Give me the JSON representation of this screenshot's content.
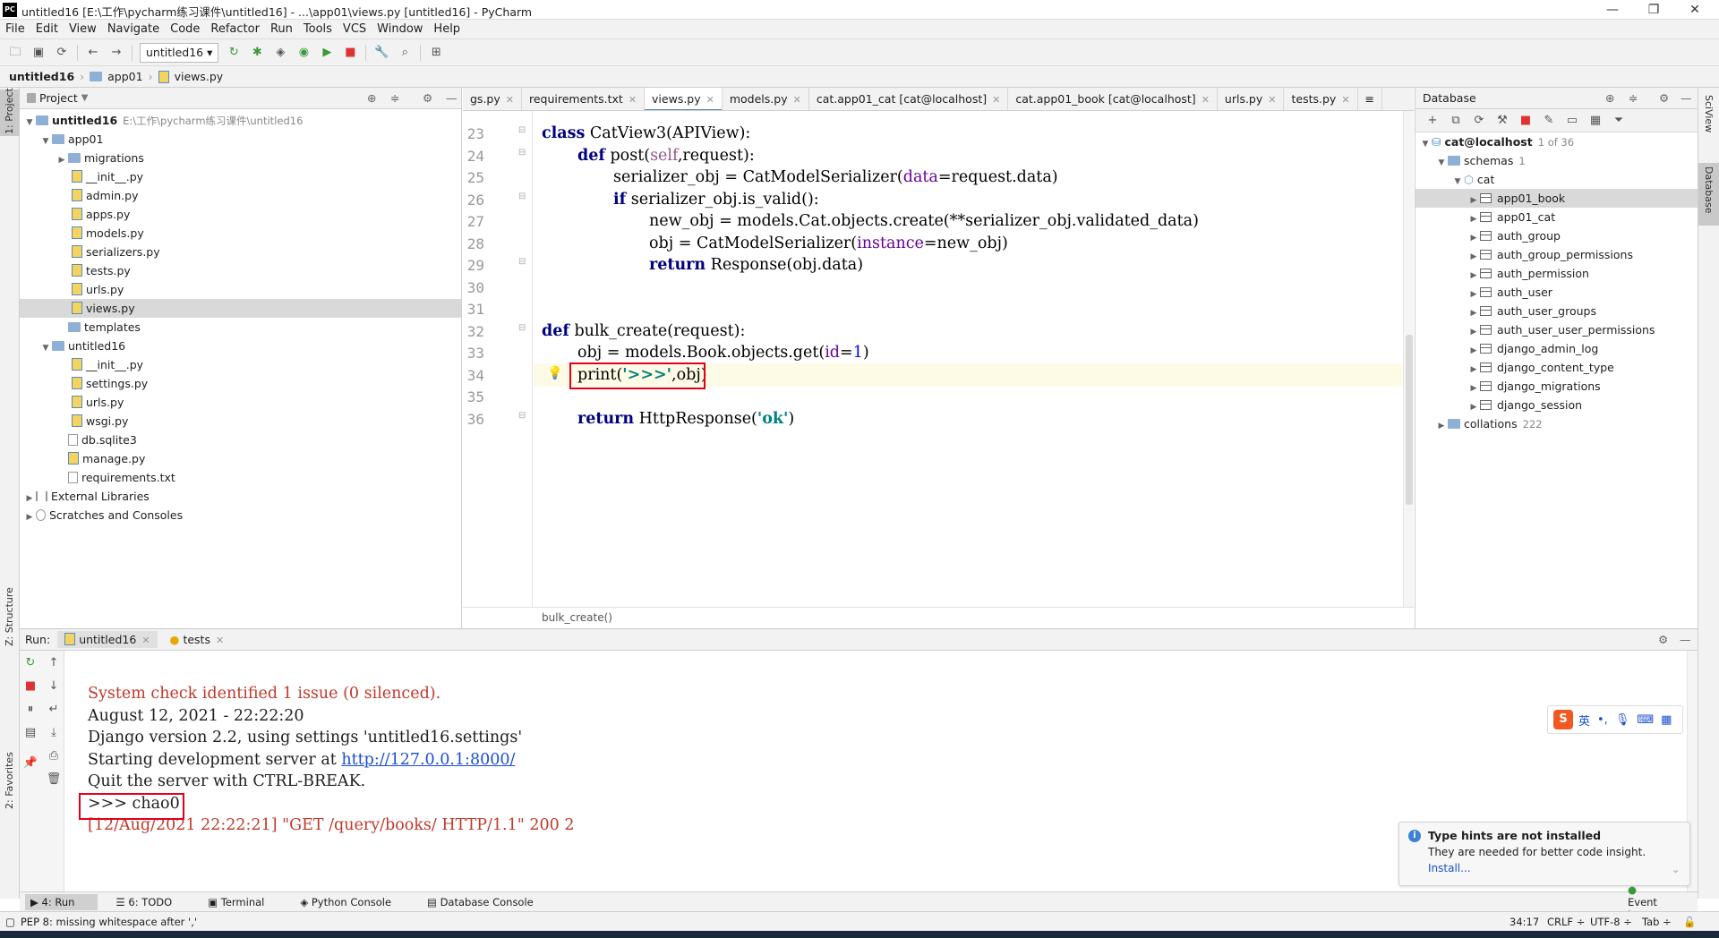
{
  "window": {
    "title": "untitled16 [E:\\工作\\pycharm练习课件\\untitled16] - ...\\app01\\views.py [untitled16] - PyCharm",
    "app_icon": "PC",
    "minimize": "—",
    "restore": "❐",
    "close": "✕"
  },
  "menu": [
    "File",
    "Edit",
    "View",
    "Navigate",
    "Code",
    "Refactor",
    "Run",
    "Tools",
    "VCS",
    "Window",
    "Help"
  ],
  "toolbar": {
    "run_config": "untitled16"
  },
  "navbar": {
    "crumbs": [
      "untitled16",
      "app01",
      "views.py"
    ]
  },
  "stripes": {
    "left_top": "1: Project",
    "left_mid": "Z: Structure",
    "left_bottom": "2: Favorites",
    "right_top": "SciView",
    "right_mid": "Database"
  },
  "project": {
    "header": "Project",
    "root": {
      "name": "untitled16",
      "path": "E:\\工作\\pycharm练习课件\\untitled16"
    },
    "items": [
      "app01",
      "migrations",
      "__init__.py",
      "admin.py",
      "apps.py",
      "models.py",
      "serializers.py",
      "tests.py",
      "urls.py",
      "views.py",
      "templates",
      "untitled16",
      "__init__.py",
      "settings.py",
      "urls.py",
      "wsgi.py",
      "db.sqlite3",
      "manage.py",
      "requirements.txt",
      "External Libraries",
      "Scratches and Consoles"
    ]
  },
  "editor": {
    "tabs": [
      "gs.py",
      "requirements.txt",
      "views.py",
      "models.py",
      "cat.app01_cat [cat@localhost]",
      "cat.app01_book [cat@localhost]",
      "urls.py",
      "tests.py"
    ],
    "tab_overflow": "≡",
    "line_numbers": [
      "23",
      "24",
      "25",
      "26",
      "27",
      "28",
      "29",
      "30",
      "31",
      "32",
      "33",
      "34",
      "35",
      "36"
    ],
    "code": {
      "l23_kw": "class",
      "l23_rest": " CatView3(APIView):",
      "l24_kw": "def",
      "l24_a": " post(",
      "l24_self": "self",
      "l24_b": ",request):",
      "l25_a": "serializer_obj = CatModelSerializer(",
      "l25_param": "data",
      "l25_b": "=request.data)",
      "l26_kw": "if",
      "l26_rest": " serializer_obj.is_valid():",
      "l27": "new_obj = models.Cat.objects.create(**serializer_obj.validated_data)",
      "l28_a": "obj = CatModelSerializer(",
      "l28_param": "instance",
      "l28_b": "=new_obj)",
      "l29_kw": "return",
      "l29_rest": " Response(obj.data)",
      "l32_kw": "def",
      "l32_rest": " bulk_create(request):",
      "l33_a": "obj = models.Book.objects.get(",
      "l33_param": "id",
      "l33_eq": "=",
      "l33_num": "1",
      "l33_b": ")",
      "l34_a": "print(",
      "l34_str": "'>>>'",
      "l34_b": ",obj)",
      "l36_kw": "return",
      "l36_a": " HttpResponse(",
      "l36_str": "'ok'",
      "l36_b": ")"
    },
    "breadcrumb": "bulk_create()"
  },
  "database": {
    "header": "Database",
    "connection": "cat@localhost",
    "connection_count": "1 of 36",
    "schemas": "schemas",
    "schemas_count": "1",
    "schema": "cat",
    "tables": [
      "app01_book",
      "app01_cat",
      "auth_group",
      "auth_group_permissions",
      "auth_permission",
      "auth_user",
      "auth_user_groups",
      "auth_user_user_permissions",
      "django_admin_log",
      "django_content_type",
      "django_migrations",
      "django_session"
    ],
    "collations": "collations",
    "collations_count": "222"
  },
  "run": {
    "label": "Run:",
    "tabs": [
      "untitled16",
      "tests"
    ],
    "console": [
      "System check identified 1 issue (0 silenced).",
      "August 12, 2021 - 22:22:20",
      "Django version 2.2, using settings 'untitled16.settings'",
      "Starting development server at ",
      "Quit the server with CTRL-BREAK.",
      ">>> chao0",
      "[12/Aug/2021 22:22:21] \"GET /query/books/ HTTP/1.1\" 200 2"
    ],
    "server_url": "http://127.0.0.1:8000/"
  },
  "notification": {
    "title": "Type hints are not installed",
    "body": "They are needed for better code insight.",
    "action": "Install..."
  },
  "ime": {
    "lang": "英"
  },
  "bottom_tabs": [
    "4: Run",
    "6: TODO",
    "Terminal",
    "Python Console",
    "Database Console"
  ],
  "event_log": "Event Log",
  "status": {
    "message": "PEP 8: missing whitespace after ','",
    "position": "34:17",
    "line_sep": "CRLF ÷",
    "encoding": "UTF-8 ÷",
    "indent": "Tab ÷"
  },
  "colors": {
    "keyword": "#000080",
    "string": "#008080",
    "error": "#c0392b",
    "highlight_box": "#e0001a"
  }
}
